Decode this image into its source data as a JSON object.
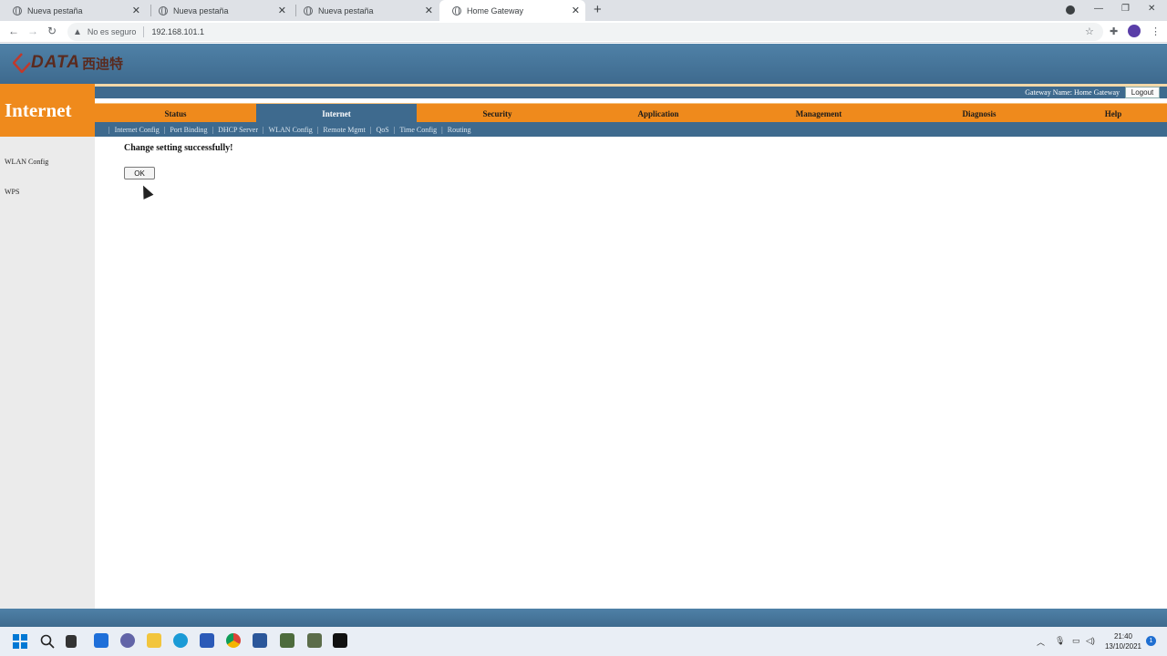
{
  "browser": {
    "tabs": [
      {
        "title": "Nueva pestaña",
        "active": false
      },
      {
        "title": "Nueva pestaña",
        "active": false
      },
      {
        "title": "Nueva pestaña",
        "active": false
      },
      {
        "title": "Home Gateway",
        "active": true
      }
    ],
    "security_label": "No es seguro",
    "url": "192.168.101.1"
  },
  "header": {
    "logo_text": "DATA",
    "logo_cn": "西迪特",
    "section_title": "Internet",
    "gateway_name": "Gateway Name: Home Gateway",
    "logout_label": "Logout"
  },
  "main_nav": [
    {
      "label": "Status",
      "active": false
    },
    {
      "label": "Internet",
      "active": true
    },
    {
      "label": "Security",
      "active": false
    },
    {
      "label": "Application",
      "active": false
    },
    {
      "label": "Management",
      "active": false
    },
    {
      "label": "Diagnosis",
      "active": false
    },
    {
      "label": "Help",
      "active": false
    }
  ],
  "sub_nav": [
    "Internet Config",
    "Port Binding",
    "DHCP Server",
    "WLAN Config",
    "Remote Mgmt",
    "QoS",
    "Time Config",
    "Routing"
  ],
  "sidebar": {
    "items": [
      "WLAN Config",
      "WPS"
    ]
  },
  "content": {
    "message": "Change setting successfully!",
    "ok_label": "OK"
  },
  "taskbar": {
    "time": "21:40",
    "date": "13/10/2021",
    "notifications": "1"
  },
  "colors": {
    "nav_orange": "#ef8a1c",
    "nav_blue": "#3e6a8e"
  }
}
